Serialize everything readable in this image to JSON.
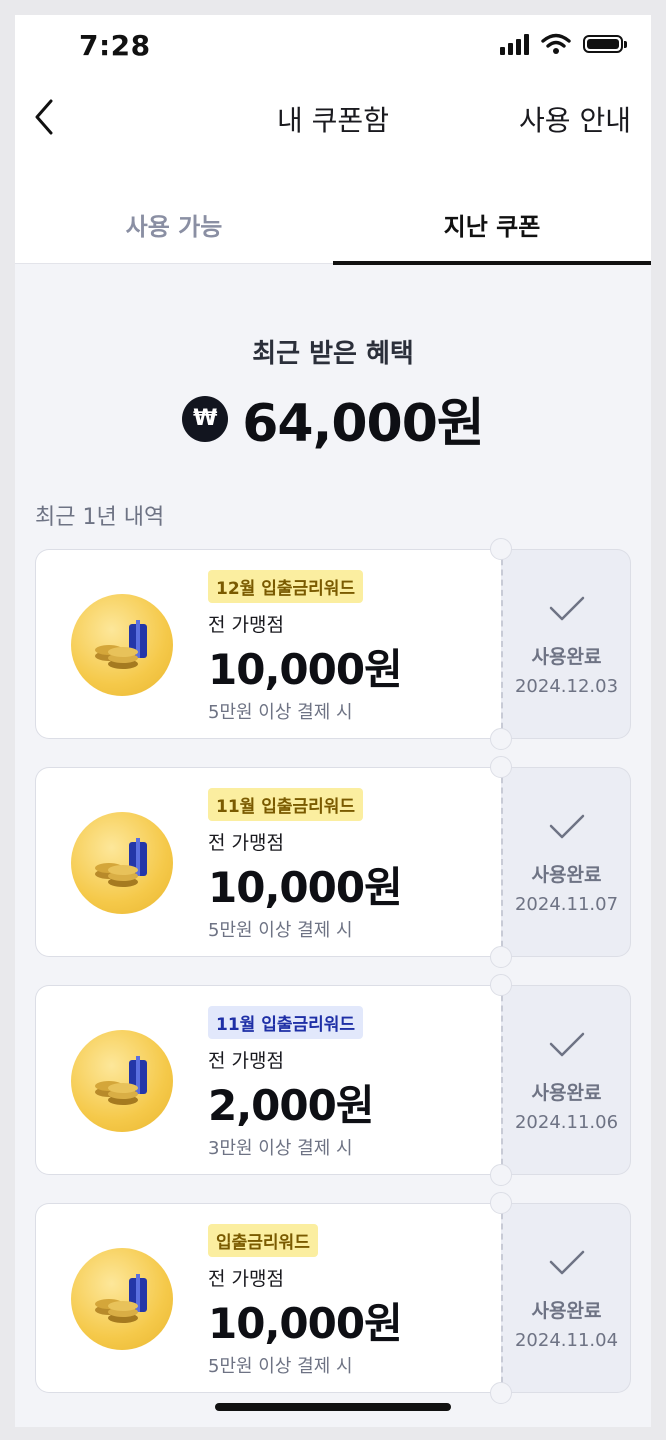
{
  "status_bar": {
    "time": "7:28"
  },
  "header": {
    "title": "내 쿠폰함",
    "guide_label": "사용 안내"
  },
  "tabs": [
    {
      "label": "사용 가능",
      "active": false
    },
    {
      "label": "지난 쿠폰",
      "active": true
    }
  ],
  "benefit": {
    "label": "최근 받은 혜택",
    "currency_symbol": "₩",
    "amount": "64,000원"
  },
  "history_label": "최근 1년 내역",
  "coupons": [
    {
      "badge": "12월 입출금리워드",
      "badge_style": "yellow",
      "store": "전 가맹점",
      "amount": "10,000원",
      "condition": "5만원 이상 결제 시",
      "status": "사용완료",
      "date": "2024.12.03"
    },
    {
      "badge": "11월 입출금리워드",
      "badge_style": "yellow",
      "store": "전 가맹점",
      "amount": "10,000원",
      "condition": "5만원 이상 결제 시",
      "status": "사용완료",
      "date": "2024.11.07"
    },
    {
      "badge": "11월 입출금리워드",
      "badge_style": "blue",
      "store": "전 가맹점",
      "amount": "2,000원",
      "condition": "3만원 이상 결제 시",
      "status": "사용완료",
      "date": "2024.11.06"
    },
    {
      "badge": "입출금리워드",
      "badge_style": "yellow",
      "store": "전 가맹점",
      "amount": "10,000원",
      "condition": "5만원 이상 결제 시",
      "status": "사용완료",
      "date": "2024.11.04"
    }
  ],
  "colors": {
    "badge_yellow": "#fbeea0",
    "badge_blue": "#e2e8fb",
    "stub_bg": "#ebedf4",
    "coin": "#f5c94a"
  }
}
